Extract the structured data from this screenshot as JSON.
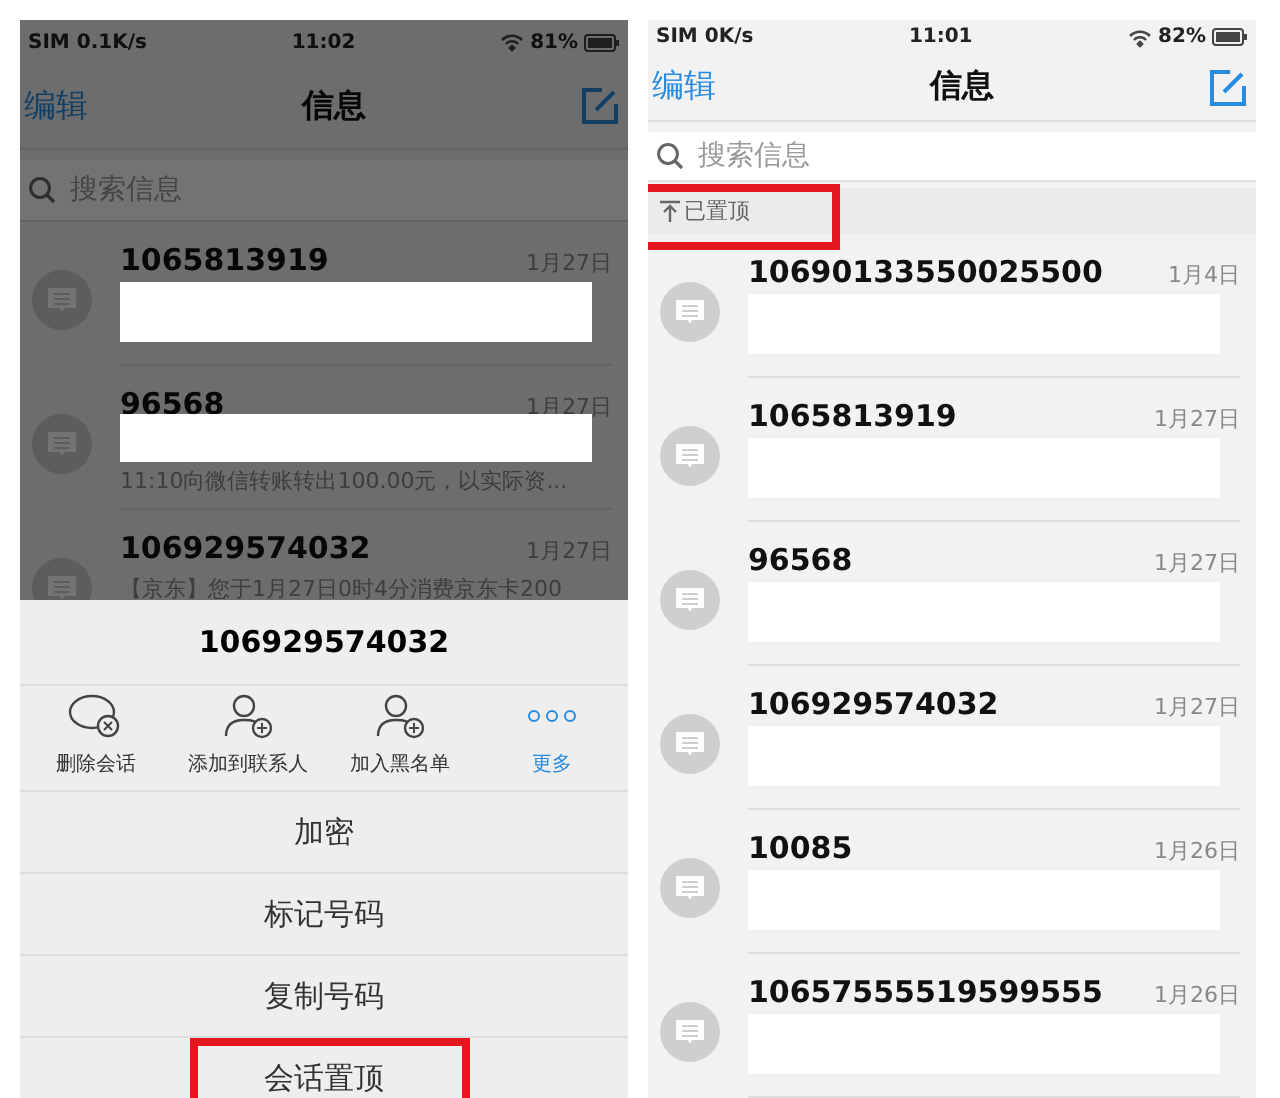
{
  "left_screen": {
    "status_bar": {
      "carrier": "SIM 0.1K/s",
      "time": "11:02",
      "battery": "81%"
    },
    "nav": {
      "edit": "编辑",
      "title": "信息"
    },
    "search": {
      "placeholder": "搜索信息"
    },
    "conversations": [
      {
        "name": "1065813919",
        "date": "1月27日",
        "redacted": true
      },
      {
        "name": "96568",
        "date": "1月27日",
        "preview": "11:10向微信转账转出100.00元，以实际资...",
        "redacted": true
      },
      {
        "name": "106929574032",
        "date": "1月27日",
        "preview": "【京东】您于1月27日0时4分消费京东卡200",
        "redacted": false
      }
    ],
    "sheet": {
      "title": "106929574032",
      "actions": [
        {
          "kind": "delete",
          "label": "删除会话"
        },
        {
          "kind": "add-contact",
          "label": "添加到联系人"
        },
        {
          "kind": "block",
          "label": "加入黑名单"
        },
        {
          "kind": "more",
          "label": "更多"
        }
      ],
      "menu": [
        {
          "label": "加密",
          "highlighted": false
        },
        {
          "label": "标记号码",
          "highlighted": false
        },
        {
          "label": "复制号码",
          "highlighted": false
        },
        {
          "label": "会话置顶",
          "highlighted": true
        }
      ]
    }
  },
  "right_screen": {
    "status_bar": {
      "carrier": "SIM 0K/s",
      "time": "11:01",
      "battery": "82%"
    },
    "nav": {
      "edit": "编辑",
      "title": "信息"
    },
    "search": {
      "placeholder": "搜索信息"
    },
    "pinned_header": {
      "label": "已置顶",
      "highlighted": true
    },
    "conversations": [
      {
        "name": "10690133550025500",
        "date": "1月4日",
        "redacted": true
      },
      {
        "name": "1065813919",
        "date": "1月27日",
        "redacted": true
      },
      {
        "name": "96568",
        "date": "1月27日",
        "redacted": true
      },
      {
        "name": "106929574032",
        "date": "1月27日",
        "redacted": true
      },
      {
        "name": "10085",
        "date": "1月26日",
        "redacted": true
      },
      {
        "name": "10657555519599555",
        "date": "1月26日",
        "redacted": true
      }
    ]
  }
}
